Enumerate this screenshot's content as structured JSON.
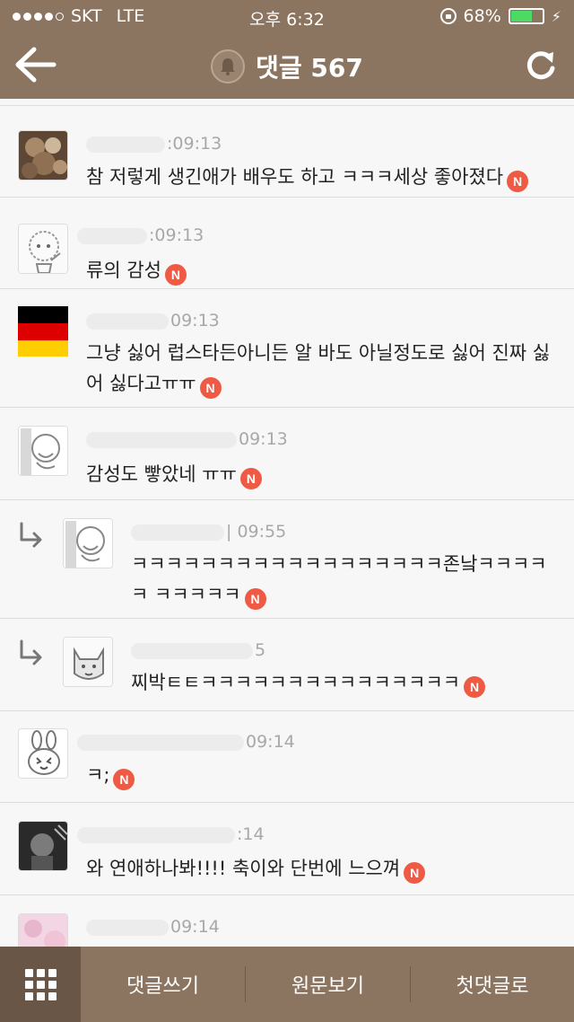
{
  "status_bar": {
    "carrier": "SKT",
    "network": "LTE",
    "time": "오후 6:32",
    "battery": "68%",
    "battery_level": 0.68
  },
  "header": {
    "title": "댓글 567"
  },
  "comments": [
    {
      "time": ":09:13",
      "text": "참 저렇게 생긴애가 배우도 하고 ㅋㅋㅋ세상 좋아졌다"
    },
    {
      "time": ":09:13",
      "text": "류의 감성"
    },
    {
      "time": "09:13",
      "text": "그냥 싫어 럽스타든아니든 알 바도 아닐정도로 싫어 진짜 싫어 싫다고ㅠㅠ"
    },
    {
      "time": "09:13",
      "text": "감성도 빻았네 ㅠㅠ"
    },
    {
      "time": "| 09:55",
      "text": "ㅋㅋㅋㅋㅋㅋㅋㅋㅋㅋㅋㅋㅋㅋㅋㅋㅋㅋ존낰ㅋㅋㅋㅋㅋ ㅋㅋㅋㅋㅋ",
      "reply": true
    },
    {
      "time": "5",
      "text": "찌박ㅌㅌㅋㅋㅋㅋㅋㅋㅋㅋㅋㅋㅋㅋㅋㅋㅋ",
      "reply": true
    },
    {
      "time": "09:14",
      "text": "ㅋ;"
    },
    {
      "time": ":14",
      "text": "와 연애하나봐!!!!  축이와 단번에 느으껴"
    },
    {
      "time": "09:14",
      "text": ""
    }
  ],
  "badge_label": "N",
  "bottom_bar": {
    "write": "댓글쓰기",
    "original": "원문보기",
    "first": "첫댓글로"
  },
  "icons": [
    "back-arrow-icon",
    "bell-icon",
    "refresh-icon",
    "grid-menu-icon",
    "reply-arrow-icon"
  ],
  "colors": {
    "bar": "#8c7560",
    "badge": "#ee5a44"
  }
}
